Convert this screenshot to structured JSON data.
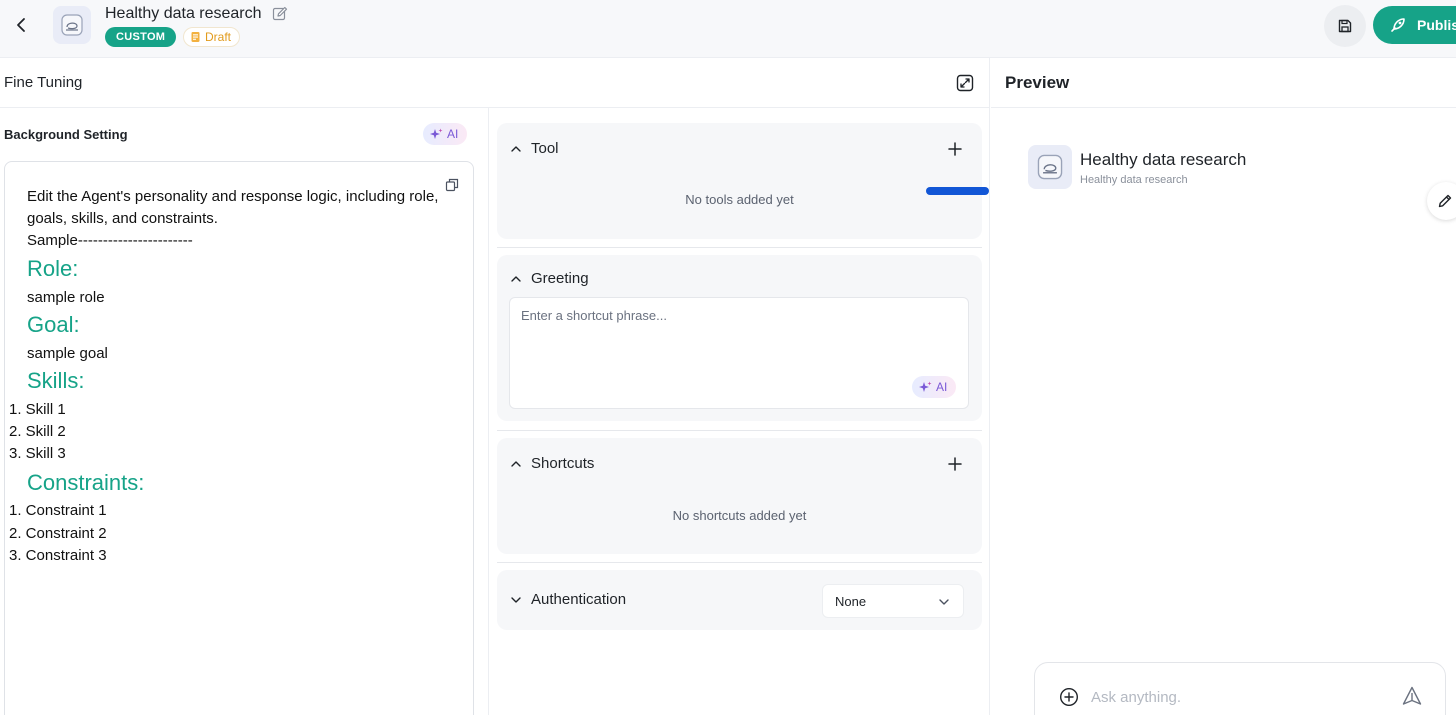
{
  "header": {
    "agent_name": "Healthy data research",
    "badge_custom": "CUSTOM",
    "badge_draft": "Draft",
    "publish_label": "Publish"
  },
  "fine_tuning": {
    "title": "Fine Tuning",
    "background": {
      "title": "Background Setting",
      "ai_label": "AI",
      "intro": "Edit the Agent's personality and response logic, including role, goals, skills, and constraints.",
      "sample": "Sample-----------------------",
      "role_heading": "Role:",
      "role_text": "sample role",
      "goal_heading": "Goal:",
      "goal_text": "sample goal",
      "skills_heading": "Skills:",
      "skills": [
        "1. Skill 1",
        "2. Skill 2",
        "3. Skill 3"
      ],
      "constraints_heading": "Constraints:",
      "constraints": [
        "1. Constraint 1",
        "2. Constraint 2",
        "3. Constraint 3"
      ]
    },
    "tool": {
      "title": "Tool",
      "empty": "No tools added yet"
    },
    "greeting": {
      "title": "Greeting",
      "placeholder": "Enter a shortcut phrase...",
      "ai_label": "AI"
    },
    "shortcuts": {
      "title": "Shortcuts",
      "empty": "No shortcuts added yet"
    },
    "authentication": {
      "title": "Authentication",
      "value": "None"
    }
  },
  "preview": {
    "title": "Preview",
    "agent_name": "Healthy data research",
    "agent_desc": "Healthy data research",
    "chat_placeholder": "Ask anything."
  },
  "colors": {
    "accent": "#16a388",
    "draft": "#e29b1c",
    "ai_purple": "#7a59d6",
    "annotation_blue": "#1256d6"
  },
  "icons": [
    "back-arrow-icon",
    "robot-avatar-icon",
    "pencil-edit-icon",
    "draft-file-icon",
    "save-disk-icon",
    "rocket-icon",
    "expand-icon",
    "sparkle-icon",
    "copy-icon",
    "chevron-up-icon",
    "plus-icon",
    "chevron-down-icon",
    "plus-circle-icon",
    "send-icon"
  ]
}
